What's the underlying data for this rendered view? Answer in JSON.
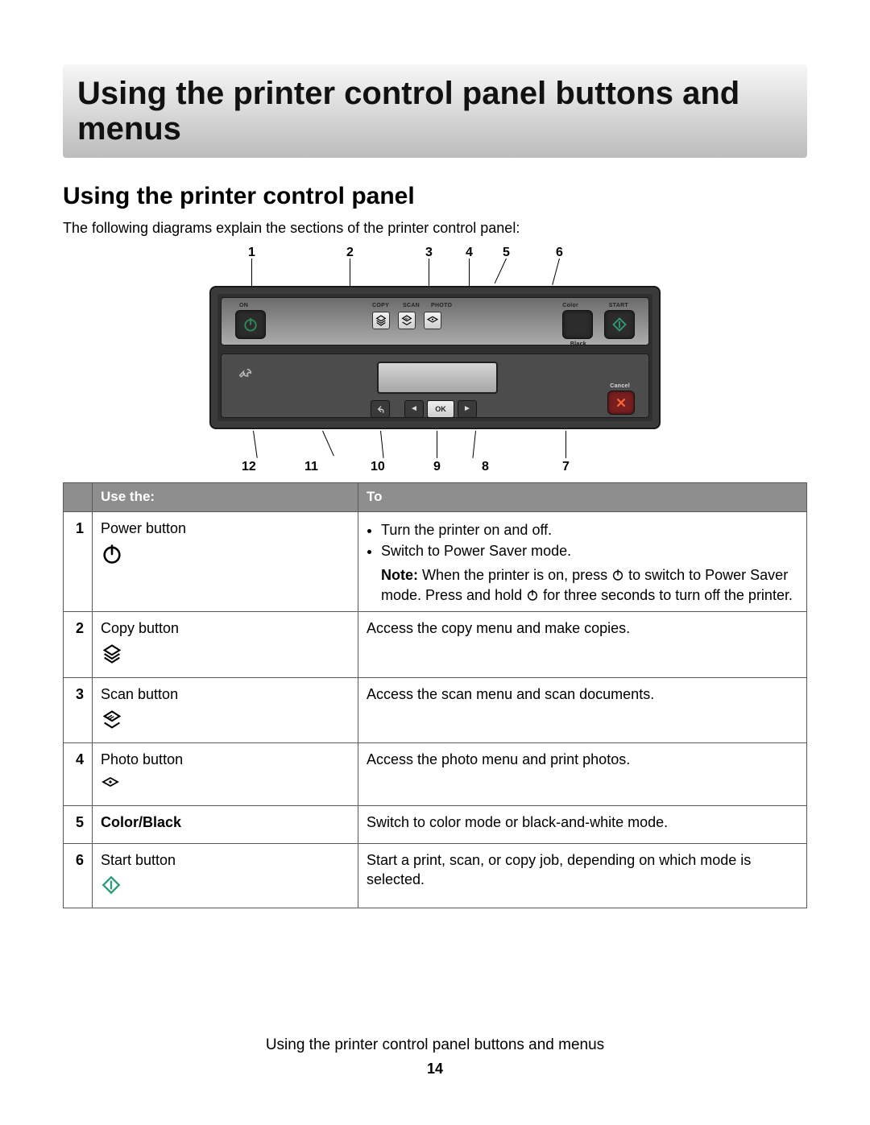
{
  "page_title": "Using the printer control panel buttons and menus",
  "section_heading": "Using the printer control panel",
  "intro": "The following diagrams explain the sections of the printer control panel:",
  "diagram": {
    "top_callouts": [
      "1",
      "2",
      "3",
      "4",
      "5",
      "6"
    ],
    "bottom_callouts": [
      "12",
      "11",
      "10",
      "9",
      "8",
      "7"
    ],
    "top_row": {
      "on_label": "ON",
      "copy_label": "COPY",
      "scan_label": "SCAN",
      "photo_label": "PHOTO",
      "color_label": "Color",
      "black_label": "Black",
      "start_label": "START"
    },
    "bottom_row": {
      "ok_label": "OK",
      "cancel_label": "Cancel"
    }
  },
  "table": {
    "headers": {
      "num": "",
      "use": "Use the:",
      "to": "To"
    },
    "rows": [
      {
        "num": "1",
        "label": "Power button",
        "icon": "power",
        "to": {
          "bullets": [
            "Turn the printer on and off.",
            "Switch to Power Saver mode."
          ],
          "note_label": "Note:",
          "note_before": " When the printer is on, press ",
          "note_mid": " to switch to Power Saver mode. Press and hold ",
          "note_after": " for three seconds to turn off the printer."
        }
      },
      {
        "num": "2",
        "label": "Copy button",
        "icon": "copy",
        "to_text": "Access the copy menu and make copies."
      },
      {
        "num": "3",
        "label": "Scan button",
        "icon": "scan",
        "to_text": "Access the scan menu and scan documents."
      },
      {
        "num": "4",
        "label": "Photo button",
        "icon": "photo",
        "to_text": "Access the photo menu and print photos."
      },
      {
        "num": "5",
        "label": "Color/Black",
        "bold": true,
        "to_text": "Switch to color mode or black-and-white mode."
      },
      {
        "num": "6",
        "label": "Start button",
        "icon": "start",
        "to_text": "Start a print, scan, or copy job, depending on which mode is selected."
      }
    ]
  },
  "footer": {
    "title": "Using the printer control panel buttons and menus",
    "page_number": "14"
  }
}
